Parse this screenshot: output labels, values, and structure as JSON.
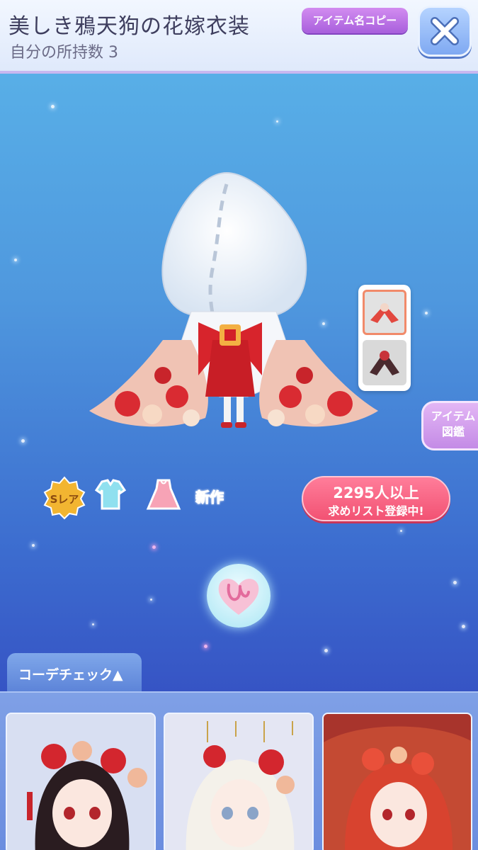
{
  "header": {
    "item_title": "美しき鴉天狗の花嫁衣装",
    "owned_count": "自分の所持数 3",
    "copy_button": "アイテム名コピー",
    "close_icon": "close-x-icon"
  },
  "side": {
    "encyclopedia_line1": "アイテム",
    "encyclopedia_line2": "図鑑"
  },
  "badges": {
    "rarity": "Sレア",
    "new_label": "新作",
    "category_icons": [
      "top-icon",
      "dress-icon"
    ]
  },
  "wishlist": {
    "count": "2295人以上",
    "text": "求めリスト登録中!"
  },
  "coord": {
    "tab_label": "コーデチェック▲"
  },
  "colors": {
    "accent_purple": "#a85fdc",
    "wish_pink": "#f25273",
    "new_red": "#e3344a"
  }
}
